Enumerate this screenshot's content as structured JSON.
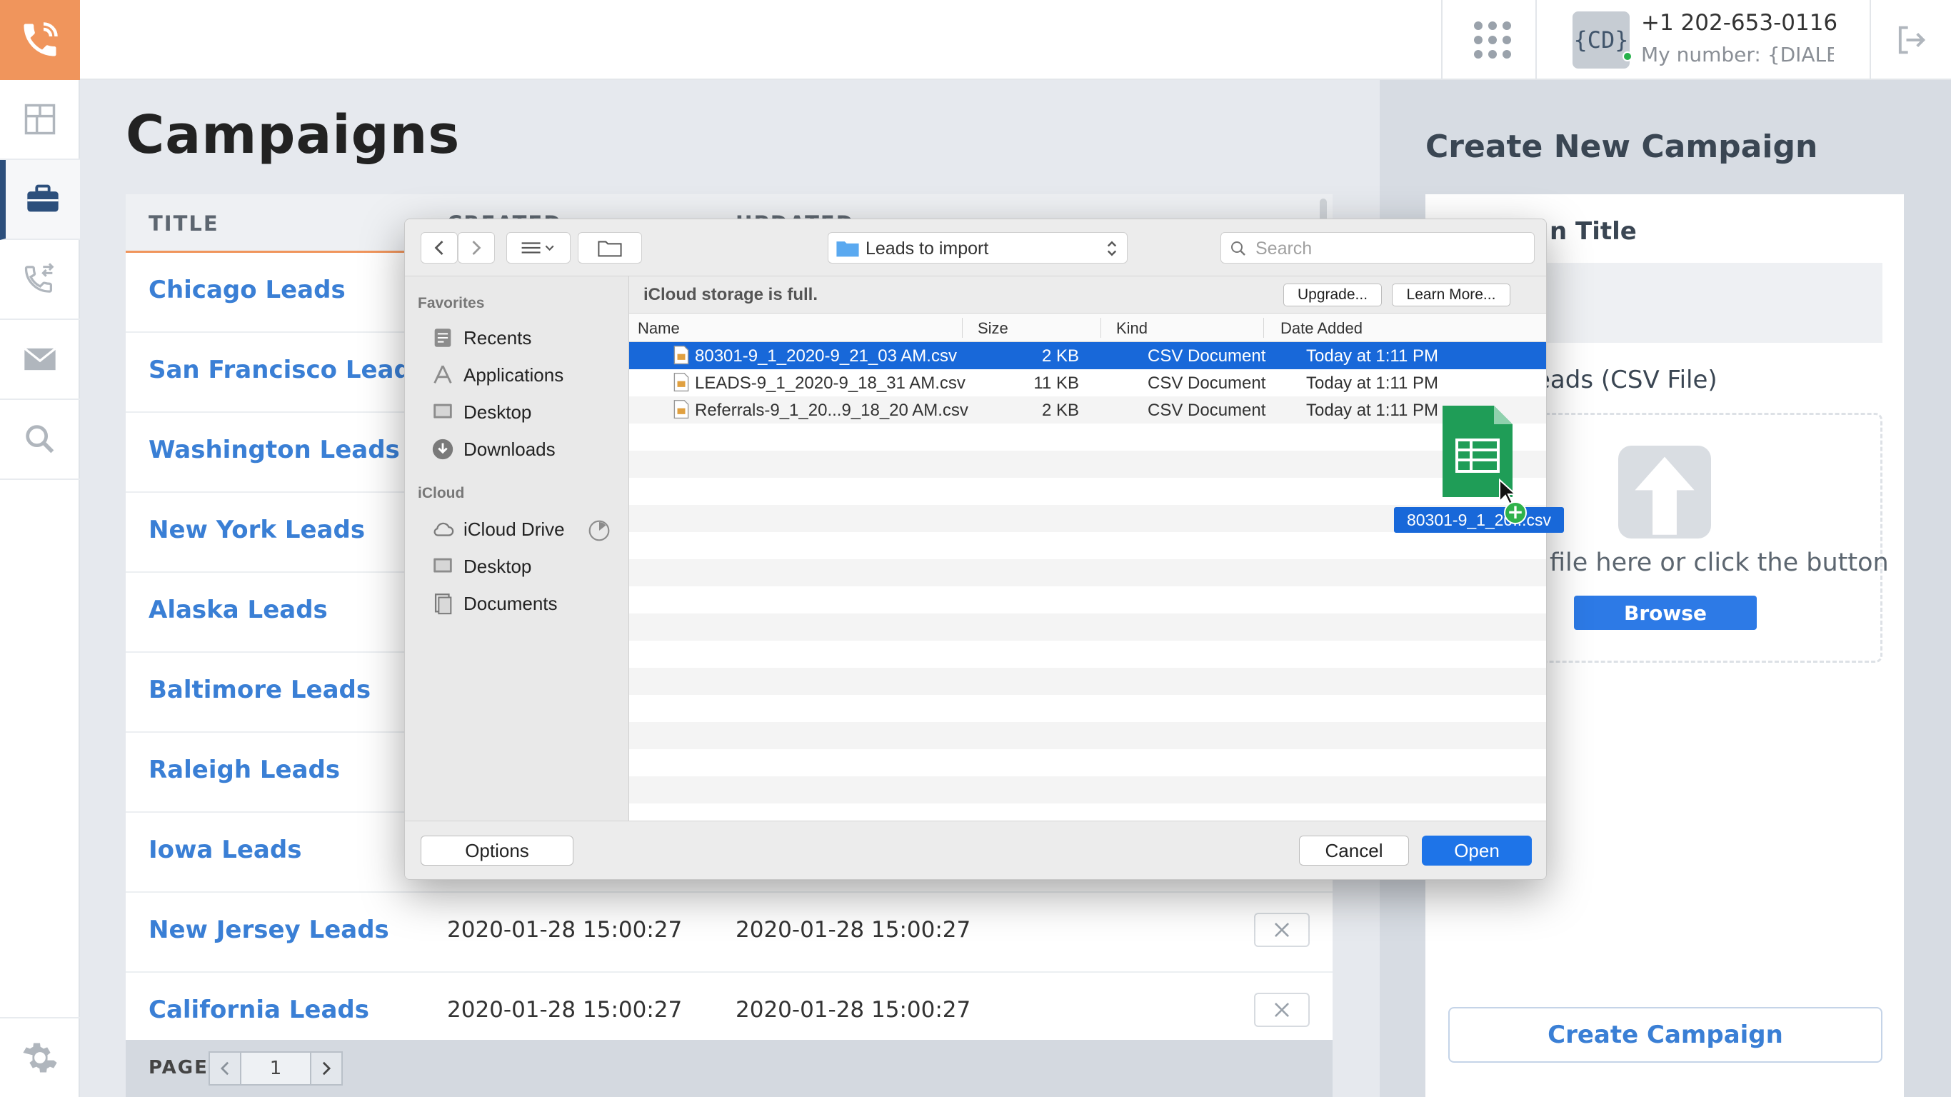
{
  "header": {
    "phone_number": "+1 202-653-0116",
    "my_number": "My number: {DIALER",
    "avatar_text": "{CD}"
  },
  "page": {
    "title": "Campaigns"
  },
  "table": {
    "columns": [
      "TITLE",
      "CREATED",
      "UPDATED"
    ],
    "rows": [
      {
        "title": "Chicago Leads",
        "created": "",
        "updated": ""
      },
      {
        "title": "San Francisco Leads",
        "created": "",
        "updated": ""
      },
      {
        "title": "Washington Leads",
        "created": "",
        "updated": ""
      },
      {
        "title": "New York Leads",
        "created": "",
        "updated": ""
      },
      {
        "title": "Alaska Leads",
        "created": "",
        "updated": ""
      },
      {
        "title": "Baltimore Leads",
        "created": "",
        "updated": ""
      },
      {
        "title": "Raleigh Leads",
        "created": "",
        "updated": ""
      },
      {
        "title": "Iowa Leads",
        "created": "",
        "updated": ""
      },
      {
        "title": "New Jersey Leads",
        "created": "2020-01-28 15:00:27",
        "updated": "2020-01-28 15:00:27"
      },
      {
        "title": "California Leads",
        "created": "2020-01-28 15:00:27",
        "updated": "2020-01-28 15:00:27"
      }
    ],
    "page_label": "PAGE",
    "page_number": "1"
  },
  "create_panel": {
    "heading": "Create New Campaign",
    "title_label": "n Title",
    "leads_label": "eads (CSV File)",
    "drop_text": "file here or click the button",
    "browse_label": "Browse",
    "create_label": "Create Campaign"
  },
  "dialog": {
    "path": "Leads to import",
    "search_placeholder": "Search",
    "favorites_heading": "Favorites",
    "favorites": [
      "Recents",
      "Applications",
      "Desktop",
      "Downloads"
    ],
    "icloud_heading": "iCloud",
    "icloud_items": [
      "iCloud Drive",
      "Desktop",
      "Documents"
    ],
    "icloud_message": "iCloud storage is full.",
    "upgrade_label": "Upgrade...",
    "learn_more_label": "Learn More...",
    "columns": {
      "name": "Name",
      "size": "Size",
      "kind": "Kind",
      "date": "Date Added"
    },
    "files": [
      {
        "name": "80301-9_1_2020-9_21_03 AM.csv",
        "size": "2 KB",
        "kind": "CSV Document",
        "date": "Today at 1:11 PM"
      },
      {
        "name": "LEADS-9_1_2020-9_18_31 AM.csv",
        "size": "11 KB",
        "kind": "CSV Document",
        "date": "Today at 1:11 PM"
      },
      {
        "name": "Referrals-9_1_20...9_18_20 AM.csv",
        "size": "2 KB",
        "kind": "CSV Document",
        "date": "Today at 1:11 PM"
      }
    ],
    "options_label": "Options",
    "cancel_label": "Cancel",
    "open_label": "Open"
  },
  "drag": {
    "file_label": "80301-9_1_2020-9_21_03 AM.csv",
    "visible_label": "80301-9_1_20...csv"
  },
  "colors": {
    "brand_orange": "#f0955c",
    "link_blue": "#3a7fd5",
    "select_blue": "#1868d9",
    "nav_dark": "#2c4f7c"
  }
}
